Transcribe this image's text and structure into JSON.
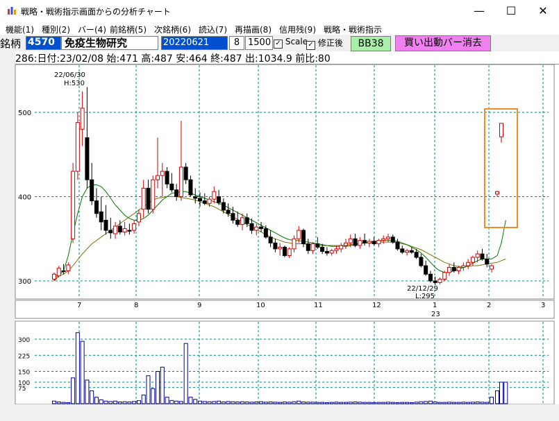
{
  "window": {
    "title": "戦略・戦術指示画面からの分析チャート",
    "minimize": "—",
    "maximize": "☐",
    "close": "✕"
  },
  "menu": [
    "機能(1)",
    "種別(2)",
    "バー(4)",
    "前銘柄(5)",
    "次銘柄(6)",
    "読込(7)",
    "再描画(8)",
    "信用残(9)",
    "戦略・戦術指示"
  ],
  "toolbar": {
    "code_label": "銘柄",
    "code_value": "4570",
    "name": "免疫生物研究",
    "date_value": "20220621",
    "num1": "8",
    "num2": "1500",
    "scale_label": "Scale",
    "scale_checked": true,
    "adjusted_label": "修正後",
    "adjusted_checked": true,
    "bb_button": "BB38",
    "clear_button": "買い出動バー消去"
  },
  "info": "286:日付:23/02/08 始:471 高:487 安:464 終:487 出:1034.9 前比:80",
  "colors": {
    "up": "#cc0000",
    "down": "#000000",
    "ma_short": "#007700",
    "ma_long": "#777700",
    "grid": "#008080",
    "volume": "#000099",
    "highlight": "#f08c28",
    "bb_button_bg": "#a8f0a8",
    "clear_button_bg": "#f080f0",
    "code_bg": "#0050d0"
  },
  "chart_data": {
    "type": "candlestick",
    "price_axis": {
      "ticks": [
        500,
        400,
        300
      ]
    },
    "month_labels": [
      "7",
      "8",
      "9",
      "10",
      "11",
      "12",
      "1",
      "2",
      "3"
    ],
    "year_label": "23",
    "annotations": [
      {
        "date": "22/06/30",
        "text": "H:530"
      },
      {
        "date": "22/12/29",
        "text": "L:295"
      }
    ],
    "volume_axis": {
      "ticks": [
        300,
        225,
        150,
        100,
        75
      ]
    },
    "candles": [
      {
        "o": 302,
        "h": 310,
        "l": 300,
        "c": 308
      },
      {
        "o": 306,
        "h": 318,
        "l": 304,
        "c": 315
      },
      {
        "o": 312,
        "h": 320,
        "l": 308,
        "c": 311
      },
      {
        "o": 312,
        "h": 322,
        "l": 308,
        "c": 319
      },
      {
        "o": 350,
        "h": 440,
        "l": 345,
        "c": 430
      },
      {
        "o": 430,
        "h": 500,
        "l": 420,
        "c": 488
      },
      {
        "o": 480,
        "h": 525,
        "l": 460,
        "c": 505
      },
      {
        "o": 470,
        "h": 530,
        "l": 410,
        "c": 420
      },
      {
        "o": 420,
        "h": 440,
        "l": 390,
        "c": 395
      },
      {
        "o": 395,
        "h": 410,
        "l": 375,
        "c": 380
      },
      {
        "o": 382,
        "h": 400,
        "l": 360,
        "c": 370
      },
      {
        "o": 372,
        "h": 390,
        "l": 355,
        "c": 360
      },
      {
        "o": 360,
        "h": 375,
        "l": 350,
        "c": 357
      },
      {
        "o": 356,
        "h": 370,
        "l": 350,
        "c": 365
      },
      {
        "o": 365,
        "h": 372,
        "l": 355,
        "c": 358
      },
      {
        "o": 358,
        "h": 370,
        "l": 354,
        "c": 362
      },
      {
        "o": 360,
        "h": 368,
        "l": 355,
        "c": 359
      },
      {
        "o": 360,
        "h": 372,
        "l": 356,
        "c": 368
      },
      {
        "o": 370,
        "h": 385,
        "l": 365,
        "c": 380
      },
      {
        "o": 385,
        "h": 420,
        "l": 375,
        "c": 410
      },
      {
        "o": 410,
        "h": 420,
        "l": 380,
        "c": 385
      },
      {
        "o": 385,
        "h": 425,
        "l": 380,
        "c": 420
      },
      {
        "o": 420,
        "h": 470,
        "l": 410,
        "c": 425
      },
      {
        "o": 425,
        "h": 440,
        "l": 400,
        "c": 430
      },
      {
        "o": 430,
        "h": 435,
        "l": 410,
        "c": 415
      },
      {
        "o": 415,
        "h": 428,
        "l": 405,
        "c": 408
      },
      {
        "o": 408,
        "h": 415,
        "l": 395,
        "c": 400
      },
      {
        "o": 400,
        "h": 490,
        "l": 395,
        "c": 435
      },
      {
        "o": 435,
        "h": 440,
        "l": 415,
        "c": 420
      },
      {
        "o": 420,
        "h": 425,
        "l": 400,
        "c": 402
      },
      {
        "o": 400,
        "h": 410,
        "l": 392,
        "c": 398
      },
      {
        "o": 398,
        "h": 405,
        "l": 388,
        "c": 395
      },
      {
        "o": 395,
        "h": 404,
        "l": 390,
        "c": 392
      },
      {
        "o": 392,
        "h": 400,
        "l": 388,
        "c": 397
      },
      {
        "o": 397,
        "h": 412,
        "l": 392,
        "c": 406
      },
      {
        "o": 400,
        "h": 408,
        "l": 390,
        "c": 393
      },
      {
        "o": 393,
        "h": 398,
        "l": 380,
        "c": 384
      },
      {
        "o": 384,
        "h": 392,
        "l": 376,
        "c": 380
      },
      {
        "o": 380,
        "h": 388,
        "l": 368,
        "c": 372
      },
      {
        "o": 372,
        "h": 382,
        "l": 364,
        "c": 367
      },
      {
        "o": 367,
        "h": 380,
        "l": 360,
        "c": 375
      },
      {
        "o": 375,
        "h": 380,
        "l": 364,
        "c": 368
      },
      {
        "o": 368,
        "h": 374,
        "l": 356,
        "c": 360
      },
      {
        "o": 360,
        "h": 368,
        "l": 354,
        "c": 364
      },
      {
        "o": 364,
        "h": 370,
        "l": 358,
        "c": 362
      },
      {
        "o": 362,
        "h": 366,
        "l": 350,
        "c": 352
      },
      {
        "o": 352,
        "h": 360,
        "l": 340,
        "c": 345
      },
      {
        "o": 345,
        "h": 350,
        "l": 334,
        "c": 338
      },
      {
        "o": 338,
        "h": 345,
        "l": 330,
        "c": 340
      },
      {
        "o": 340,
        "h": 342,
        "l": 328,
        "c": 330
      },
      {
        "o": 330,
        "h": 340,
        "l": 327,
        "c": 338
      },
      {
        "o": 338,
        "h": 354,
        "l": 334,
        "c": 350
      },
      {
        "o": 350,
        "h": 365,
        "l": 345,
        "c": 360
      },
      {
        "o": 360,
        "h": 362,
        "l": 340,
        "c": 344
      },
      {
        "o": 344,
        "h": 350,
        "l": 332,
        "c": 336
      },
      {
        "o": 336,
        "h": 346,
        "l": 332,
        "c": 344
      },
      {
        "o": 344,
        "h": 352,
        "l": 338,
        "c": 340
      },
      {
        "o": 340,
        "h": 344,
        "l": 332,
        "c": 335
      },
      {
        "o": 335,
        "h": 340,
        "l": 330,
        "c": 333
      },
      {
        "o": 333,
        "h": 338,
        "l": 330,
        "c": 336
      },
      {
        "o": 336,
        "h": 342,
        "l": 332,
        "c": 338
      },
      {
        "o": 338,
        "h": 345,
        "l": 334,
        "c": 342
      },
      {
        "o": 342,
        "h": 350,
        "l": 338,
        "c": 345
      },
      {
        "o": 345,
        "h": 355,
        "l": 340,
        "c": 350
      },
      {
        "o": 350,
        "h": 356,
        "l": 340,
        "c": 342
      },
      {
        "o": 342,
        "h": 352,
        "l": 338,
        "c": 348
      },
      {
        "o": 348,
        "h": 356,
        "l": 342,
        "c": 345
      },
      {
        "o": 345,
        "h": 350,
        "l": 340,
        "c": 347
      },
      {
        "o": 347,
        "h": 352,
        "l": 342,
        "c": 344
      },
      {
        "o": 344,
        "h": 350,
        "l": 340,
        "c": 348
      },
      {
        "o": 348,
        "h": 354,
        "l": 344,
        "c": 350
      },
      {
        "o": 350,
        "h": 356,
        "l": 346,
        "c": 352
      },
      {
        "o": 352,
        "h": 355,
        "l": 344,
        "c": 346
      },
      {
        "o": 346,
        "h": 350,
        "l": 336,
        "c": 338
      },
      {
        "o": 338,
        "h": 342,
        "l": 332,
        "c": 334
      },
      {
        "o": 334,
        "h": 338,
        "l": 330,
        "c": 336
      },
      {
        "o": 336,
        "h": 340,
        "l": 332,
        "c": 334
      },
      {
        "o": 334,
        "h": 338,
        "l": 326,
        "c": 328
      },
      {
        "o": 328,
        "h": 332,
        "l": 316,
        "c": 318
      },
      {
        "o": 318,
        "h": 324,
        "l": 306,
        "c": 308
      },
      {
        "o": 308,
        "h": 312,
        "l": 298,
        "c": 300
      },
      {
        "o": 300,
        "h": 305,
        "l": 295,
        "c": 298
      },
      {
        "o": 298,
        "h": 304,
        "l": 296,
        "c": 302
      },
      {
        "o": 302,
        "h": 312,
        "l": 300,
        "c": 310
      },
      {
        "o": 310,
        "h": 320,
        "l": 306,
        "c": 316
      },
      {
        "o": 316,
        "h": 322,
        "l": 310,
        "c": 312
      },
      {
        "o": 312,
        "h": 318,
        "l": 308,
        "c": 316
      },
      {
        "o": 316,
        "h": 322,
        "l": 312,
        "c": 318
      },
      {
        "o": 318,
        "h": 326,
        "l": 314,
        "c": 322
      },
      {
        "o": 322,
        "h": 330,
        "l": 318,
        "c": 328
      },
      {
        "o": 328,
        "h": 336,
        "l": 322,
        "c": 332
      },
      {
        "o": 332,
        "h": 338,
        "l": 324,
        "c": 326
      },
      {
        "o": 326,
        "h": 332,
        "l": 316,
        "c": 320
      },
      {
        "o": 314,
        "h": 320,
        "l": 310,
        "c": 318
      },
      {
        "o": 403,
        "h": 407,
        "l": 400,
        "c": 406
      },
      {
        "o": 471,
        "h": 487,
        "l": 464,
        "c": 487
      }
    ],
    "ma_short": [
      300,
      306,
      312,
      330,
      356,
      380,
      400,
      410,
      414,
      414,
      412,
      406,
      398,
      390,
      384,
      378,
      374,
      372,
      372,
      374,
      378,
      384,
      390,
      396,
      400,
      404,
      405,
      406,
      406,
      404,
      402,
      400,
      398,
      396,
      394,
      392,
      390,
      387,
      384,
      381,
      378,
      375,
      372,
      369,
      366,
      363,
      360,
      357,
      354,
      351,
      349,
      348,
      348,
      347,
      346,
      345,
      344,
      343,
      342,
      341,
      341,
      341,
      341,
      342,
      343,
      344,
      345,
      346,
      347,
      347,
      348,
      348,
      348,
      347,
      345,
      343,
      340,
      337,
      333,
      328,
      322,
      316,
      312,
      310,
      310,
      312,
      314,
      316,
      318,
      321,
      324,
      326,
      326,
      326,
      330,
      345,
      372
    ],
    "ma_long": [
      305,
      306,
      308,
      312,
      318,
      325,
      332,
      338,
      344,
      348,
      352,
      356,
      360,
      364,
      368,
      372,
      376,
      380,
      384,
      388,
      392,
      396,
      398,
      399,
      400,
      400,
      400,
      399,
      398,
      397,
      396,
      394,
      392,
      390,
      388,
      385,
      382,
      379,
      376,
      373,
      370,
      367,
      364,
      361,
      358,
      355,
      352,
      350,
      348,
      346,
      345,
      344,
      344,
      344,
      343,
      343,
      342,
      342,
      342,
      342,
      342,
      342,
      343,
      343,
      344,
      344,
      345,
      345,
      345,
      346,
      346,
      346,
      346,
      345,
      344,
      343,
      341,
      339,
      337,
      334,
      331,
      328,
      325,
      322,
      320,
      318,
      317,
      317,
      317,
      318,
      318,
      319,
      320,
      321,
      322,
      324,
      326
    ],
    "volumes": [
      12,
      8,
      6,
      5,
      120,
      330,
      290,
      110,
      60,
      30,
      18,
      12,
      10,
      12,
      8,
      9,
      8,
      10,
      14,
      40,
      130,
      70,
      150,
      170,
      30,
      15,
      12,
      10,
      280,
      30,
      20,
      12,
      10,
      9,
      10,
      12,
      8,
      10,
      9,
      8,
      9,
      8,
      7,
      8,
      9,
      7,
      8,
      7,
      6,
      8,
      7,
      9,
      12,
      8,
      7,
      7,
      6,
      6,
      5,
      6,
      7,
      6,
      6,
      7,
      8,
      7,
      6,
      6,
      5,
      6,
      6,
      7,
      6,
      5,
      6,
      6,
      5,
      7,
      9,
      10,
      12,
      8,
      6,
      6,
      7,
      6,
      6,
      7,
      6,
      7,
      8,
      7,
      6,
      30,
      60,
      100,
      100
    ]
  }
}
